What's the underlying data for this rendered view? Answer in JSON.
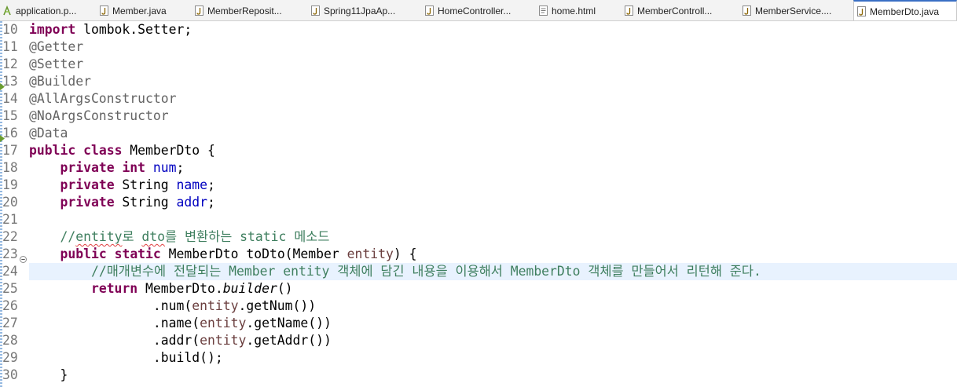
{
  "tabs": [
    {
      "label": "application.p...",
      "icon": "properties-file-icon",
      "active": false
    },
    {
      "label": "Member.java",
      "icon": "java-file-icon",
      "active": false
    },
    {
      "label": "MemberReposit...",
      "icon": "java-file-icon",
      "active": false
    },
    {
      "label": "Spring11JpaAp...",
      "icon": "java-file-icon",
      "active": false
    },
    {
      "label": "HomeController...",
      "icon": "java-file-icon",
      "active": false
    },
    {
      "label": "home.html",
      "icon": "html-file-icon",
      "active": false
    },
    {
      "label": "MemberControll...",
      "icon": "java-file-icon",
      "active": false
    },
    {
      "label": "MemberService....",
      "icon": "java-file-icon",
      "active": false
    },
    {
      "label": "MemberDto.java",
      "icon": "java-file-icon",
      "active": true
    }
  ],
  "editor": {
    "current_line": 24,
    "lines": [
      {
        "num": "10",
        "text": "import lombok.Setter;"
      },
      {
        "num": "11",
        "text": "@Getter"
      },
      {
        "num": "12",
        "text": "@Setter"
      },
      {
        "num": "13",
        "text": "@Builder",
        "marker": "annotation-marker-icon"
      },
      {
        "num": "14",
        "text": "@AllArgsConstructor"
      },
      {
        "num": "15",
        "text": "@NoArgsConstructor"
      },
      {
        "num": "16",
        "text": "@Data",
        "marker": "annotation-marker-icon"
      },
      {
        "num": "17",
        "text": "public class MemberDto {"
      },
      {
        "num": "18",
        "text": "    private int num;"
      },
      {
        "num": "19",
        "text": "    private String name;"
      },
      {
        "num": "20",
        "text": "    private String addr;"
      },
      {
        "num": "21",
        "text": ""
      },
      {
        "num": "22",
        "text": "    //entity로 dto를 변환하는 static 메소드"
      },
      {
        "num": "23",
        "text": "    public static MemberDto toDto(Member entity) {",
        "fold": "collapse-icon"
      },
      {
        "num": "24",
        "text": "        //매개변수에 전달되는 Member entity 객체에 담긴 내용을 이용해서 MemberDto 객체를 만들어서 리턴해 준다."
      },
      {
        "num": "25",
        "text": "        return MemberDto.builder()"
      },
      {
        "num": "26",
        "text": "                .num(entity.getNum())"
      },
      {
        "num": "27",
        "text": "                .name(entity.getName())"
      },
      {
        "num": "28",
        "text": "                .addr(entity.getAddr())"
      },
      {
        "num": "29",
        "text": "                .build();"
      },
      {
        "num": "30",
        "text": "    }"
      }
    ]
  },
  "colors": {
    "keyword": "#7f0055",
    "annotation": "#646464",
    "field": "#0000c0",
    "comment": "#3f7f5f",
    "parameter": "#6a3e3e",
    "current_line_bg": "#e8f2fe",
    "active_tab_accent": "#3a6fc4"
  }
}
